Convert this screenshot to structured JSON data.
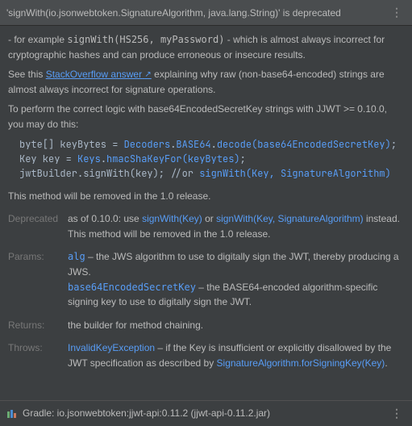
{
  "header": {
    "title": "'signWith(io.jsonwebtoken.SignatureAlgorithm, java.lang.String)' is deprecated"
  },
  "body": {
    "p1_prefix": "- for example ",
    "p1_code": "signWith(HS256, myPassword)",
    "p1_suffix": " - which is almost always incorrect for cryptographic hashes and can produce erroneous or insecure results.",
    "p2_prefix": "See this ",
    "p2_link": "StackOverflow answer",
    "p2_suffix": " explaining why raw (non-base64-encoded) strings are almost always incorrect for signature operations.",
    "p3": "To perform the correct logic with base64EncodedSecretKey strings with JJWT >= 0.10.0, you may do this:",
    "p4": "This method will be removed in the 1.0 release."
  },
  "code": {
    "l1_a": "byte[] keyBytes = ",
    "l1_b": "Decoders",
    "l1_c": ".",
    "l1_d": "BASE64",
    "l1_e": ".",
    "l1_f": "decode(base64EncodedSecretKey)",
    "l1_g": ";",
    "l2_a": "Key key = ",
    "l2_b": "Keys",
    "l2_c": ".",
    "l2_d": "hmacShaKeyFor(keyBytes)",
    "l2_e": ";",
    "l3_a": "jwtBuilder.signWith(key); //or ",
    "l3_b": "signWith(Key, SignatureAlgorithm)"
  },
  "table": {
    "deprecated_label": "Deprecated",
    "deprecated_v1": "as of 0.10.0: use ",
    "deprecated_link1": "signWith(Key)",
    "deprecated_or": " or ",
    "deprecated_link2": "signWith(Key, SignatureAlgorithm)",
    "deprecated_v2": " instead. This method will be removed in the 1.0 release.",
    "params_label": "Params:",
    "params_alg_name": "alg",
    "params_alg_desc": " – the JWS algorithm to use to digitally sign the JWT, thereby producing a JWS.",
    "params_key_name": "base64EncodedSecretKey",
    "params_key_desc": " – the BASE64-encoded algorithm-specific signing key to use to digitally sign the JWT.",
    "returns_label": "Returns:",
    "returns_value": "the builder for method chaining.",
    "throws_label": "Throws:",
    "throws_name": "InvalidKeyException",
    "throws_desc": " – if the Key is insufficient or explicitly disallowed by the JWT specification as described by ",
    "throws_link": "SignatureAlgorithm.forSigningKey(Key)",
    "throws_dot": "."
  },
  "footer": {
    "text": "Gradle: io.jsonwebtoken:jjwt-api:0.11.2 (jjwt-api-0.11.2.jar)"
  }
}
